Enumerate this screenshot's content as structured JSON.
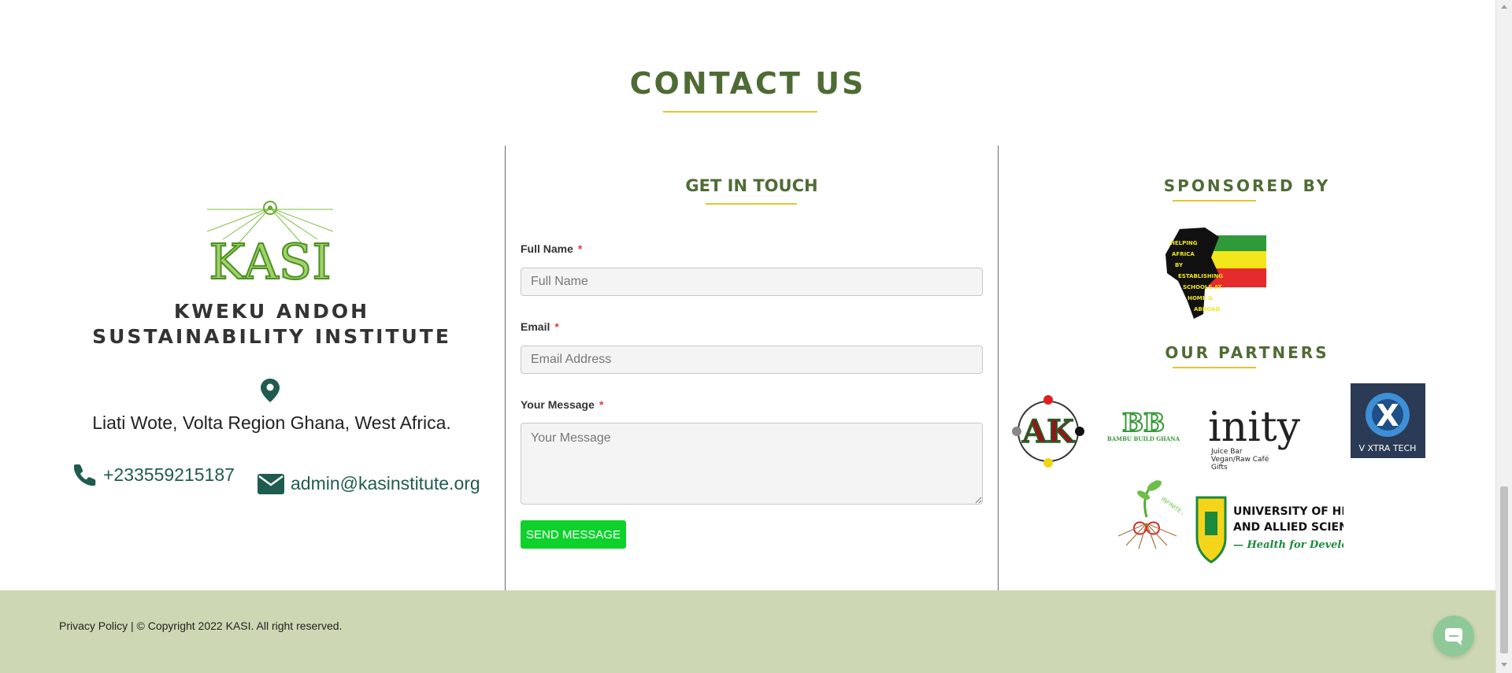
{
  "contact": {
    "title": "CONTACT US"
  },
  "left": {
    "institute_name": "KWEKU ANDOH SUSTAINABILITY INSTITUTE",
    "logo_text": "KASI",
    "address": "Liati Wote, Volta Region Ghana, West Africa.",
    "phone": "+233559215187",
    "email": "admin@kasinstitute.org"
  },
  "form": {
    "title": "GET IN TOUCH",
    "full_name_label": "Full Name",
    "full_name_placeholder": "Full Name",
    "email_label": "Email",
    "email_placeholder": "Email Address",
    "message_label": "Your Message",
    "message_placeholder": "Your Message",
    "required_mark": "*",
    "send_label": "SEND MESSAGE"
  },
  "sponsors": {
    "title": "SPONSORED BY",
    "habesha_lines": [
      "HELPING",
      "AFRICA",
      "BY",
      "ESTABLISHING",
      "SCHOOLS AT",
      "HOME &",
      "ABROAD"
    ]
  },
  "partners": {
    "title": "OUR PARTNERS",
    "ak_text": "AK",
    "bambu_mark": "BB",
    "bambu_name": "BAMBU BUILD GHANA",
    "inity_word": "inity",
    "inity_items": [
      "Juice Bar",
      "Vegan/Raw Café",
      "Gifts"
    ],
    "vxtra_mark": "X",
    "vxtra_name": "V XTRA TECH",
    "roots_text": "INFINITE ROOTS",
    "uhas_line1": "UNIVERSITY OF HEALTH",
    "uhas_line2": "AND ALLIED SCIENCES, HO",
    "uhas_motto": "— Health for Development —"
  },
  "footer": {
    "text": "Privacy Policy |  © Copyright 2022 KASI. All right reserved."
  },
  "colors": {
    "heading_green": "#4f6b35",
    "accent_yellow": "#e3c531",
    "button_green": "#0fd12c",
    "footer_bg": "#cdd7b3",
    "link_teal": "#1f5c4f"
  }
}
